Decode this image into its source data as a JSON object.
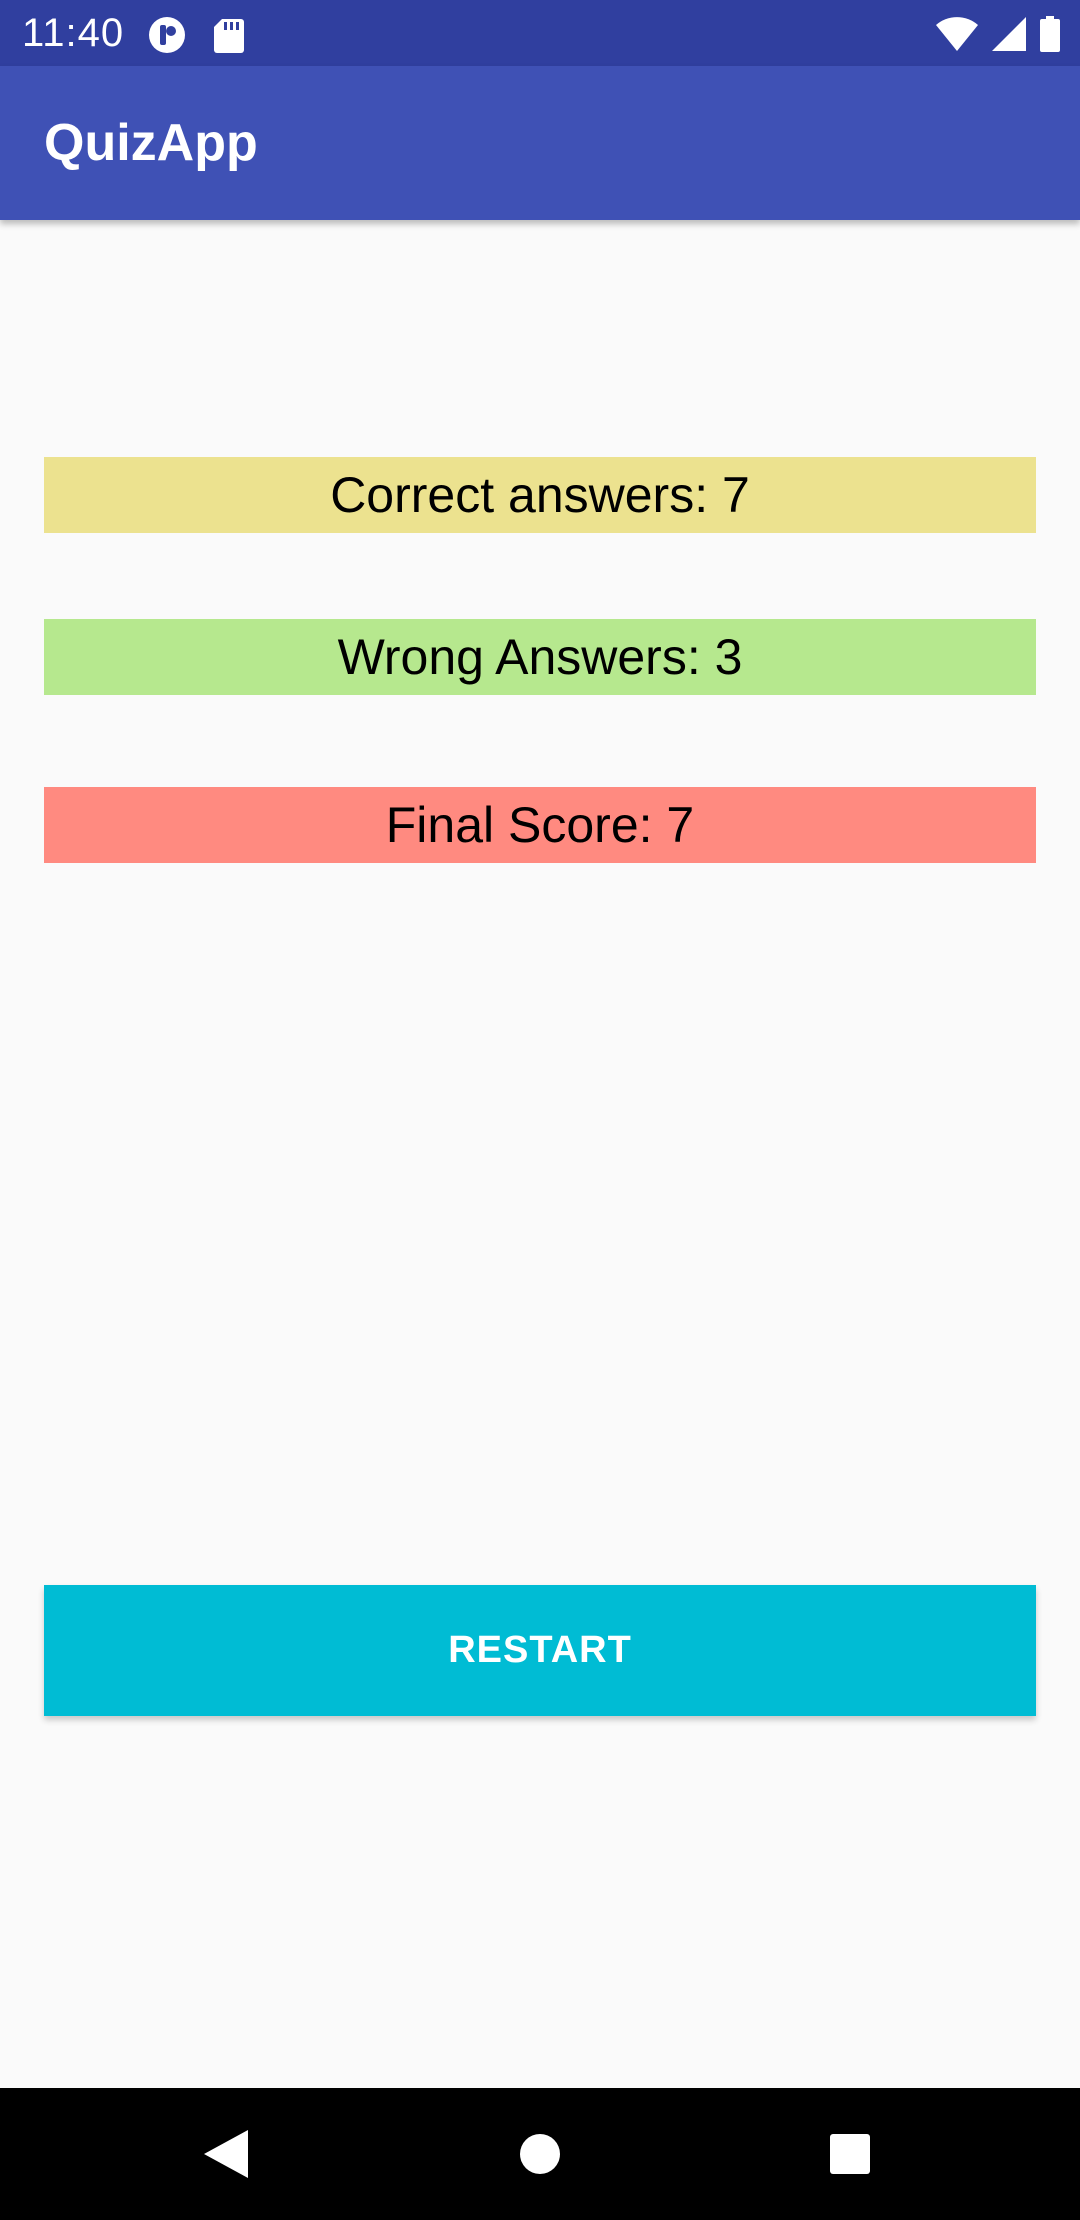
{
  "status_bar": {
    "time": "11:40",
    "icons": [
      "notification-app-icon",
      "sd-card-icon",
      "wifi-icon",
      "signal-icon",
      "battery-icon"
    ],
    "background_color": "#303f9f"
  },
  "app_bar": {
    "title": "QuizApp",
    "background_color": "#3f51b5"
  },
  "results": {
    "correct": {
      "label": "Correct answers: 7",
      "color": "#ece28f"
    },
    "wrong": {
      "label": "Wrong Answers: 3",
      "color": "#b6e88e"
    },
    "score": {
      "label": "Final Score: 7",
      "color": "#ff8a80"
    }
  },
  "restart_button": {
    "label": "RESTART",
    "color": "#00bcd4"
  },
  "nav_bar": {
    "buttons": [
      "back-icon",
      "home-icon",
      "recents-icon"
    ]
  }
}
